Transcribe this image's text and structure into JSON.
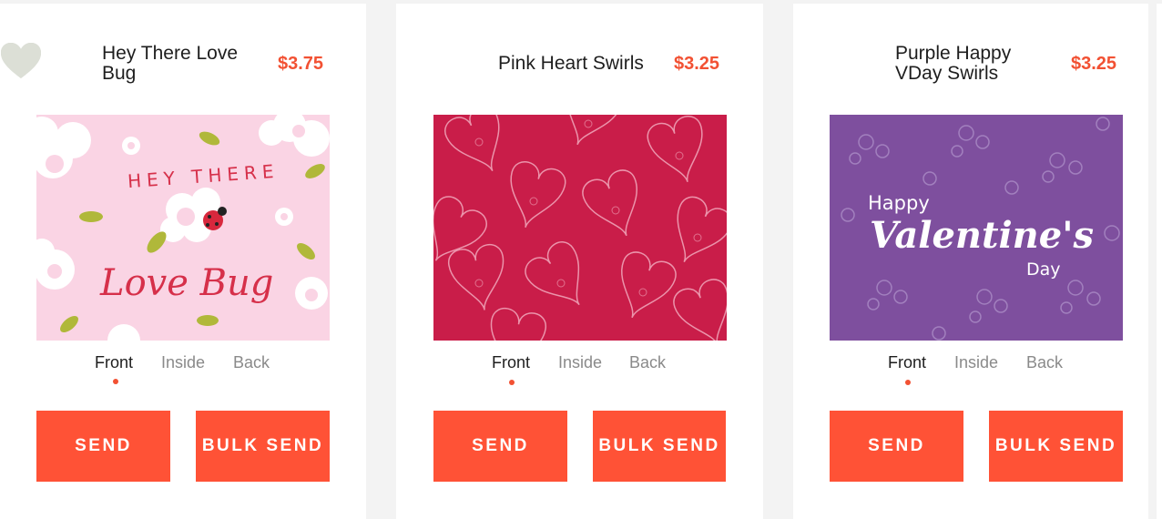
{
  "cards": [
    {
      "title": "Hey There Love Bug",
      "price": "$3.75",
      "tabs": [
        "Front",
        "Inside",
        "Back"
      ],
      "active_tab": "Front",
      "send_label": "SEND",
      "bulk_label": "BULK SEND",
      "art_text": [
        "HEY THERE",
        "Love Bug"
      ]
    },
    {
      "title": "Pink Heart Swirls",
      "price": "$3.25",
      "tabs": [
        "Front",
        "Inside",
        "Back"
      ],
      "active_tab": "Front",
      "send_label": "SEND",
      "bulk_label": "BULK SEND",
      "art_text": []
    },
    {
      "title": "Purple Happy VDay Swirls",
      "price": "$3.25",
      "tabs": [
        "Front",
        "Inside",
        "Back"
      ],
      "active_tab": "Front",
      "send_label": "SEND",
      "bulk_label": "BULK SEND",
      "art_text": [
        "Happy",
        "Valentine's",
        "Day"
      ]
    }
  ],
  "colors": {
    "accent": "#ff5236",
    "price": "#f25133",
    "heart_icon": "#dcdfd6",
    "card1_bg": "#fad4e4",
    "card2_bg": "#c91d49",
    "card3_bg": "#7e4f9e"
  }
}
